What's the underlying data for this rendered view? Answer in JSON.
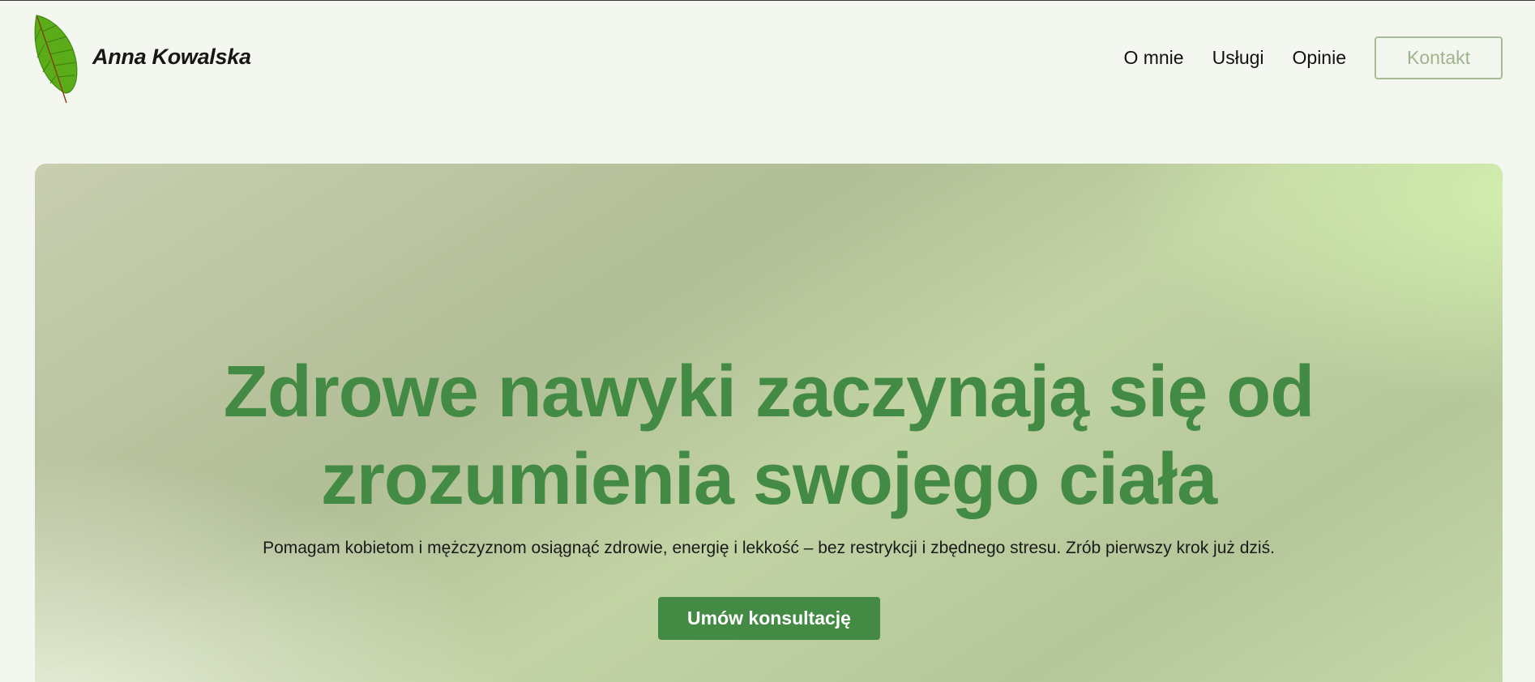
{
  "header": {
    "brand_name": "Anna Kowalska",
    "logo_icon": "leaf-icon",
    "nav": [
      {
        "label": "O mnie"
      },
      {
        "label": "Usługi"
      },
      {
        "label": "Opinie"
      }
    ],
    "contact_label": "Kontakt"
  },
  "hero": {
    "title_line1": "Zdrowe nawyki zaczynają się od",
    "title_line2": "zrozumienia swojego ciała",
    "subtitle": "Pomagam kobietom i mężczyznom osiągnąć zdrowie, energię i lekkość – bez restrykcji i zbędnego stresu. Zrób pierwszy krok już dziś.",
    "cta_label": "Umów konsultację"
  },
  "colors": {
    "accent": "#438a44",
    "page_background": "#f4f6f0",
    "contact_border": "#a9bc97",
    "leaf": "#5aad18"
  }
}
